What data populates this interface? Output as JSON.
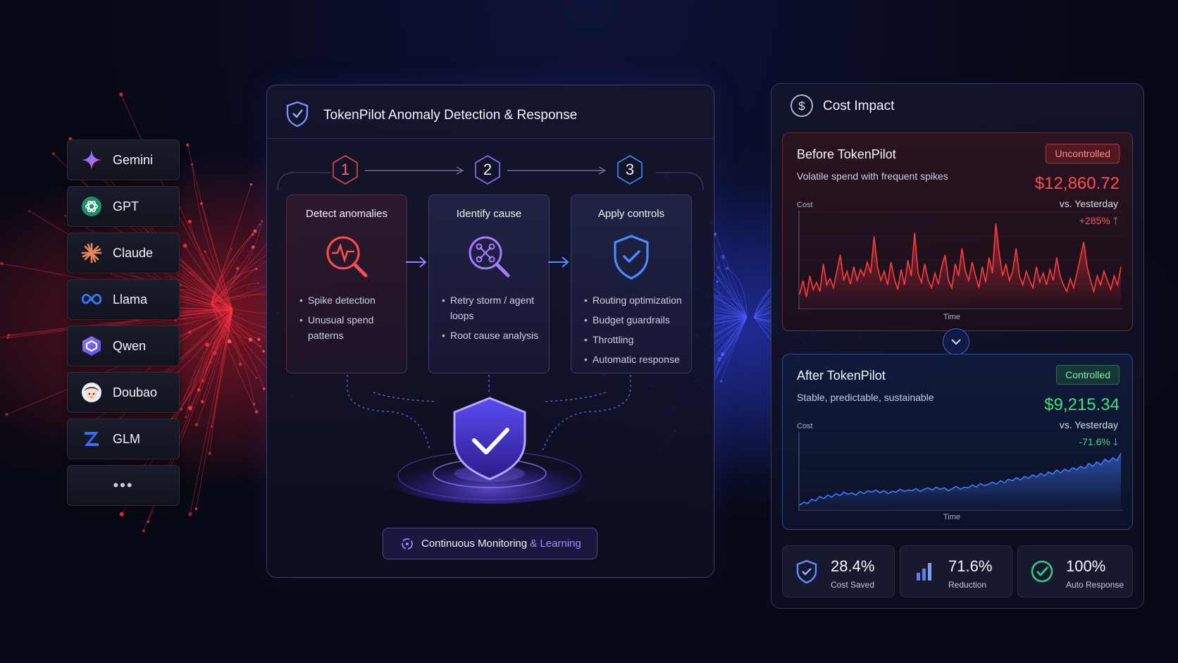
{
  "models": [
    {
      "label": "Gemini",
      "icon": "gemini-sparkle-icon"
    },
    {
      "label": "GPT",
      "icon": "openai-knot-icon"
    },
    {
      "label": "Claude",
      "icon": "claude-starburst-icon"
    },
    {
      "label": "Llama",
      "icon": "meta-infinity-icon"
    },
    {
      "label": "Qwen",
      "icon": "qwen-hexagon-icon"
    },
    {
      "label": "Doubao",
      "icon": "doubao-avatar-icon"
    },
    {
      "label": "GLM",
      "icon": "glm-z-icon"
    },
    {
      "label": "•••",
      "icon": "more-dots-icon"
    }
  ],
  "pipeline": {
    "title": "TokenPilot Anomaly Detection & Response",
    "steps": [
      {
        "number": "1",
        "title": "Detect anomalies",
        "items": [
          "Spike detection",
          "Unusual spend patterns"
        ],
        "color": "#e5484d"
      },
      {
        "number": "2",
        "title": "Identify cause",
        "items": [
          "Retry storm / agent loops",
          "Root cause analysis"
        ],
        "color": "#9b6bff"
      },
      {
        "number": "3",
        "title": "Apply controls",
        "items": [
          "Routing optimization",
          "Budget guardrails",
          "Throttling",
          "Automatic response"
        ],
        "color": "#3d8bff"
      }
    ],
    "monitor": {
      "prefix": "Continuous Monitoring ",
      "amp": "&",
      "suffix": " Learning"
    }
  },
  "cost_impact": {
    "title": "Cost Impact",
    "before": {
      "title": "Before TokenPilot",
      "badge": "Uncontrolled",
      "subtitle": "Volatile spend with frequent spikes",
      "amount": "$12,860.72",
      "compare": "vs. Yesterday",
      "delta": "+285%",
      "y_label": "Cost",
      "x_label": "Time",
      "color": "#ff3b3f"
    },
    "after": {
      "title": "After TokenPilot",
      "badge": "Controlled",
      "subtitle": "Stable, predictable, sustainable",
      "amount": "$9,215.34",
      "compare": "vs. Yesterday",
      "delta": "-71.6%",
      "y_label": "Cost",
      "x_label": "Time",
      "color": "#3f7bff"
    },
    "stats": [
      {
        "value": "28.4%",
        "label": "Cost Saved",
        "icon": "shield-check-icon"
      },
      {
        "value": "71.6%",
        "label": "Reduction",
        "icon": "bar-chart-icon"
      },
      {
        "value": "100%",
        "label": "Auto Response",
        "icon": "check-circle-icon"
      }
    ]
  },
  "chart_data": [
    {
      "type": "area",
      "title": "Before TokenPilot",
      "ylabel": "Cost",
      "xlabel": "Time",
      "series": [
        {
          "values": [
            0.15,
            0.3,
            0.12,
            0.35,
            0.2,
            0.28,
            0.18,
            0.48,
            0.25,
            0.32,
            0.22,
            0.4,
            0.58,
            0.3,
            0.4,
            0.26,
            0.45,
            0.3,
            0.42,
            0.35,
            0.5,
            0.38,
            0.78,
            0.45,
            0.3,
            0.4,
            0.25,
            0.5,
            0.32,
            0.2,
            0.42,
            0.25,
            0.52,
            0.35,
            0.82,
            0.38,
            0.28,
            0.48,
            0.3,
            0.22,
            0.38,
            0.26,
            0.45,
            0.58,
            0.3,
            0.22,
            0.48,
            0.35,
            0.65,
            0.4,
            0.3,
            0.5,
            0.35,
            0.22,
            0.45,
            0.28,
            0.55,
            0.38,
            0.92,
            0.6,
            0.35,
            0.48,
            0.3,
            0.4,
            0.65,
            0.35,
            0.25,
            0.4,
            0.3,
            0.22,
            0.45,
            0.28,
            0.38,
            0.25,
            0.42,
            0.3,
            0.55,
            0.35,
            0.25,
            0.18,
            0.32,
            0.22,
            0.38,
            0.55,
            0.72,
            0.45,
            0.3,
            0.18,
            0.35,
            0.25,
            0.4,
            0.3,
            0.2,
            0.35,
            0.25,
            0.45
          ]
        }
      ]
    },
    {
      "type": "area",
      "title": "After TokenPilot",
      "ylabel": "Cost",
      "xlabel": "Time",
      "series": [
        {
          "values": [
            0.06,
            0.1,
            0.08,
            0.14,
            0.12,
            0.18,
            0.15,
            0.2,
            0.17,
            0.22,
            0.19,
            0.24,
            0.21,
            0.23,
            0.2,
            0.25,
            0.22,
            0.26,
            0.24,
            0.27,
            0.23,
            0.26,
            0.22,
            0.25,
            0.24,
            0.28,
            0.25,
            0.27,
            0.26,
            0.29,
            0.25,
            0.28,
            0.3,
            0.27,
            0.31,
            0.28,
            0.3,
            0.26,
            0.29,
            0.32,
            0.28,
            0.31,
            0.3,
            0.34,
            0.31,
            0.36,
            0.33,
            0.35,
            0.38,
            0.35,
            0.4,
            0.37,
            0.42,
            0.4,
            0.44,
            0.41,
            0.46,
            0.43,
            0.48,
            0.45,
            0.5,
            0.47,
            0.52,
            0.49,
            0.55,
            0.51,
            0.56,
            0.53,
            0.58,
            0.55,
            0.6,
            0.57,
            0.64,
            0.6,
            0.66,
            0.62,
            0.7,
            0.66,
            0.72,
            0.68,
            0.78
          ]
        }
      ]
    }
  ]
}
